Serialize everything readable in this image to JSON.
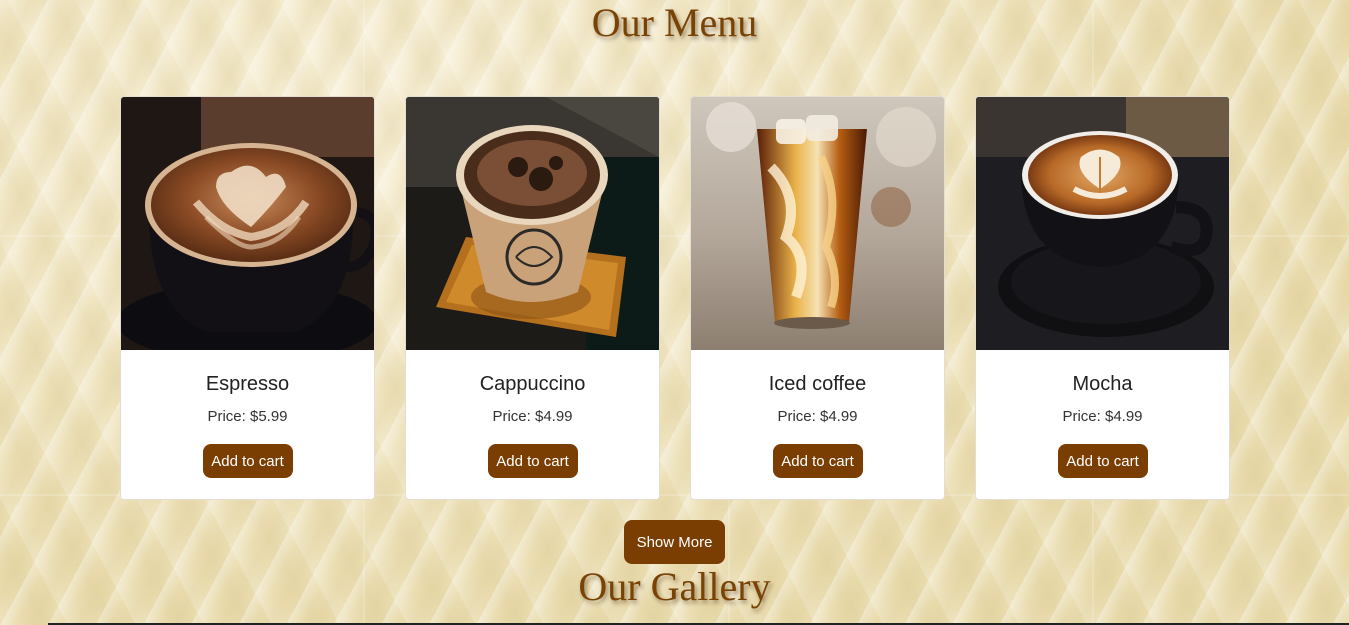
{
  "menu": {
    "title": "Our Menu",
    "items": [
      {
        "name": "Espresso",
        "price": "Price: $5.99",
        "button": "Add to cart",
        "image": "latte-art-cup-image"
      },
      {
        "name": "Cappuccino",
        "price": "Price: $4.99",
        "button": "Add to cart",
        "image": "paper-cup-coffee-image"
      },
      {
        "name": "Iced coffee",
        "price": "Price: $4.99",
        "button": "Add to cart",
        "image": "iced-coffee-glass-image"
      },
      {
        "name": "Mocha",
        "price": "Price: $4.99",
        "button": "Add to cart",
        "image": "latte-saucer-image"
      }
    ],
    "show_more": "Show More"
  },
  "gallery": {
    "title": "Our Gallery"
  },
  "colors": {
    "accent": "#7b3e02",
    "title": "#7a4306",
    "background": "#efe5c2"
  }
}
